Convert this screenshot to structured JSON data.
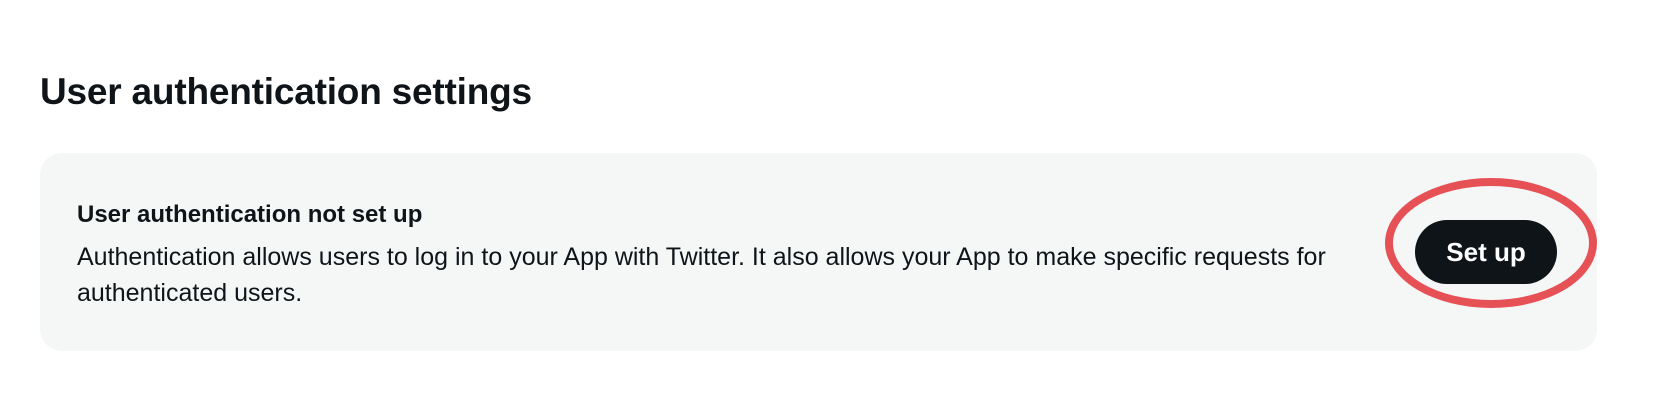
{
  "section": {
    "title": "User authentication settings"
  },
  "card": {
    "heading": "User authentication not set up",
    "body": "Authentication allows users to log in to your App with Twitter. It also allows your App to make specific requests for authenticated users.",
    "button_label": "Set up"
  },
  "annotation": {
    "highlight_color": "#e5484d"
  },
  "colors": {
    "card_background": "#f5f7f7",
    "button_background": "#0f1419",
    "button_text": "#ffffff",
    "text": "#0f1419"
  }
}
